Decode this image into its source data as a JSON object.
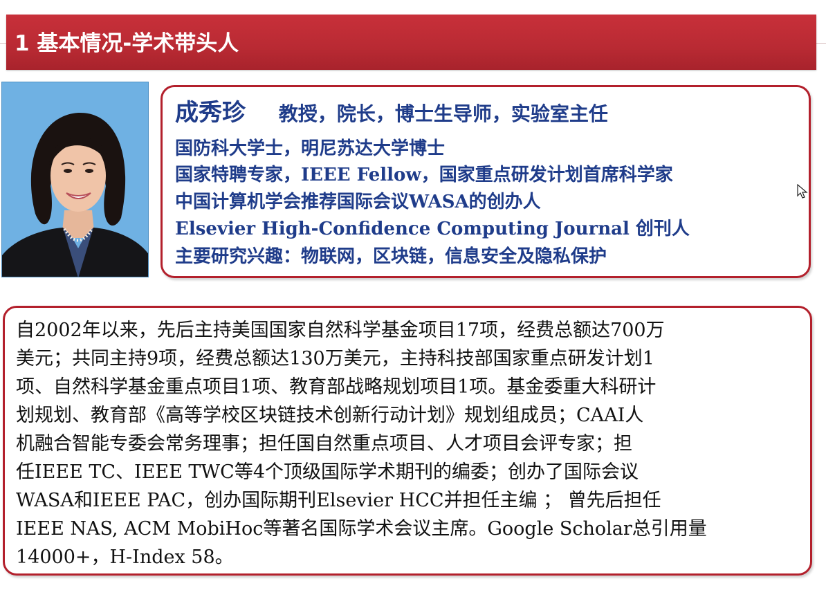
{
  "header": {
    "title": "1  基本情况-学术带头人"
  },
  "profile": {
    "name": "成秀珍",
    "roles": "教授，院长，博士生导师，实验室主任",
    "lines": [
      "国防科大学士，明尼苏达大学博士",
      "国家特聘专家，IEEE Fellow，国家重点研发计划首席科学家",
      "中国计算机学会推荐国际会议WASA的创办人",
      "Elsevier High-Confidence Computing Journal 创刊人",
      "主要研究兴趣：物联网，区块链，信息安全及隐私保护"
    ]
  },
  "bio": {
    "lines": [
      "自2002年以来，先后主持美国国家自然科学基金项目17项，经费总额达700万",
      "美元；共同主持9项，经费总额达130万美元，主持科技部国家重点研发计划1",
      "项、自然科学基金重点项目1项、教育部战略规划项目1项。基金委重大科研计",
      "划规划、教育部《高等学校区块链技术创新行动计划》规划组成员；CAAI人",
      "机融合智能专委会常务理事；担任国自然重点项目、人才项目会评专家；担",
      "任IEEE    TC、IEEE    TWC等4个顶级国际学术期刊的编委；创办了国际会议",
      "WASA和IEEE    PAC，创办国际期刊Elsevier    HCC并担任主编 ；  曾先后担任",
      "IEEE NAS, ACM MobiHoc等著名国际学术会议主席。Google Scholar总引用量",
      "14000+，H-Index 58。"
    ]
  },
  "colors": {
    "title_bar": "#b92a33",
    "box_border": "#b3202c",
    "profile_text": "#1f3c8a",
    "photo_background": "#6fb1e3"
  },
  "icons": {
    "cursor": "mouse-pointer-icon"
  }
}
